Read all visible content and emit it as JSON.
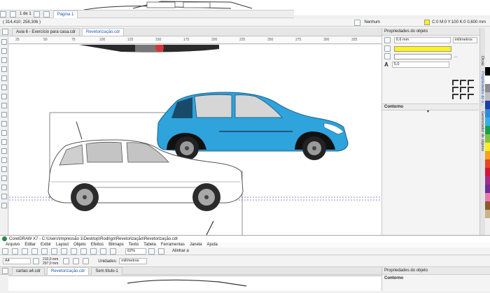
{
  "top_window": {
    "page_nav": {
      "counter": "1 de 1",
      "page_tab": "Página 1"
    },
    "coords": "( 314,410; 258,306 )",
    "fill_status": "Nenhum",
    "outline_status": "C:0 M:0 Y:100 K:0  0,600 mm",
    "tabs": [
      {
        "label": "Aula 6 - Exercício para casa.cdr"
      },
      {
        "label": "Revetorização.cdr"
      }
    ],
    "ruler_numbers": [
      "25",
      "50",
      "75",
      "100",
      "125",
      "150",
      "175",
      "200",
      "225",
      "250",
      "275",
      "300",
      "325"
    ]
  },
  "docker": {
    "title": "Propriedades do objeto",
    "outline_width": "0,6 mm",
    "units": "milímetros",
    "miter": "5,0",
    "section": "Contorno",
    "vertical_tabs": [
      "Dicas",
      "Propriedades do o...",
      "Gerenciador de objetos"
    ],
    "colors": {
      "fill": "#fff31a",
      "outline": "#ffffff"
    }
  },
  "palette": [
    "#000000",
    "#ffffff",
    "#8c8c8c",
    "#c0c0c0",
    "#1f3fa8",
    "#2e8bd9",
    "#33b0e8",
    "#14a050",
    "#7fc241",
    "#ffef1a",
    "#f6a21c",
    "#e8461e",
    "#d4143a",
    "#a02d8c",
    "#6b2f9a",
    "#e87ab0",
    "#8a5a2b",
    "#c9b48a"
  ],
  "bottom_window": {
    "title": "CorelDRAW X7 - C:\\Users\\Impressão 1\\Desktop\\Rodrigo\\Revetorização\\Revetorização.cdr",
    "menu": [
      "Arquivo",
      "Editar",
      "Exibir",
      "Layout",
      "Objeto",
      "Efeitos",
      "Bitmaps",
      "Texto",
      "Tabela",
      "Ferramentas",
      "Janela",
      "Ajuda"
    ],
    "zoom": "62%",
    "align_label": "Alinhar a",
    "paper": "A4",
    "width": "210,0 mm",
    "height": "297,0 mm",
    "units_label": "Unidades:",
    "units_value": "milímetros",
    "tabs": [
      {
        "label": "cartao a4.cdr"
      },
      {
        "label": "Revetorização.cdr"
      },
      {
        "label": "Sem título-1"
      }
    ],
    "docker_title": "Propriedades do objeto",
    "docker_section": "Contorno"
  }
}
